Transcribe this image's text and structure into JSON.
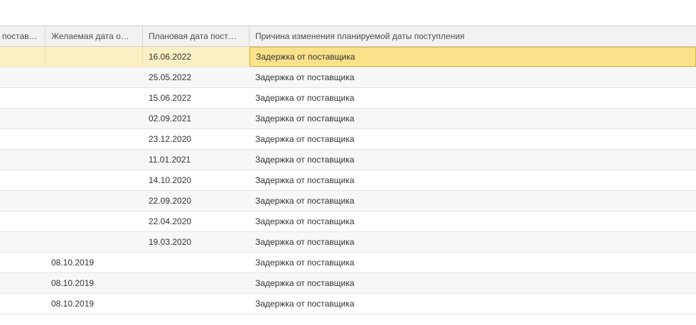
{
  "table": {
    "columns": [
      "постав…",
      "Желаемая дата о…",
      "Плановая дата пост…",
      "Причина изменения планируемой даты поступления"
    ],
    "rows": [
      {
        "desired_date": "",
        "planned_date": "16.06.2022",
        "reason": "Задержка от поставщика",
        "selected": true
      },
      {
        "desired_date": "",
        "planned_date": "25.05.2022",
        "reason": "Задержка от поставщика"
      },
      {
        "desired_date": "",
        "planned_date": "15.06.2022",
        "reason": "Задержка от поставщика"
      },
      {
        "desired_date": "",
        "planned_date": "02.09.2021",
        "reason": "Задержка от поставщика"
      },
      {
        "desired_date": "",
        "planned_date": "23.12.2020",
        "reason": "Задержка от поставщика"
      },
      {
        "desired_date": "",
        "planned_date": "11.01.2021",
        "reason": "Задержка от поставщика"
      },
      {
        "desired_date": "",
        "planned_date": "14.10.2020",
        "reason": "Задержка от поставщика"
      },
      {
        "desired_date": "",
        "planned_date": "22.09.2020",
        "reason": "Задержка от поставщика"
      },
      {
        "desired_date": "",
        "planned_date": "22.04.2020",
        "reason": "Задержка от поставщика"
      },
      {
        "desired_date": "",
        "planned_date": "19.03.2020",
        "reason": "Задержка от поставщика"
      },
      {
        "desired_date": "08.10.2019",
        "planned_date": "",
        "reason": "Задержка от поставщика"
      },
      {
        "desired_date": "08.10.2019",
        "planned_date": "",
        "reason": "Задержка от поставщика"
      },
      {
        "desired_date": "08.10.2019",
        "planned_date": "",
        "reason": "Задержка от поставщика"
      }
    ]
  }
}
